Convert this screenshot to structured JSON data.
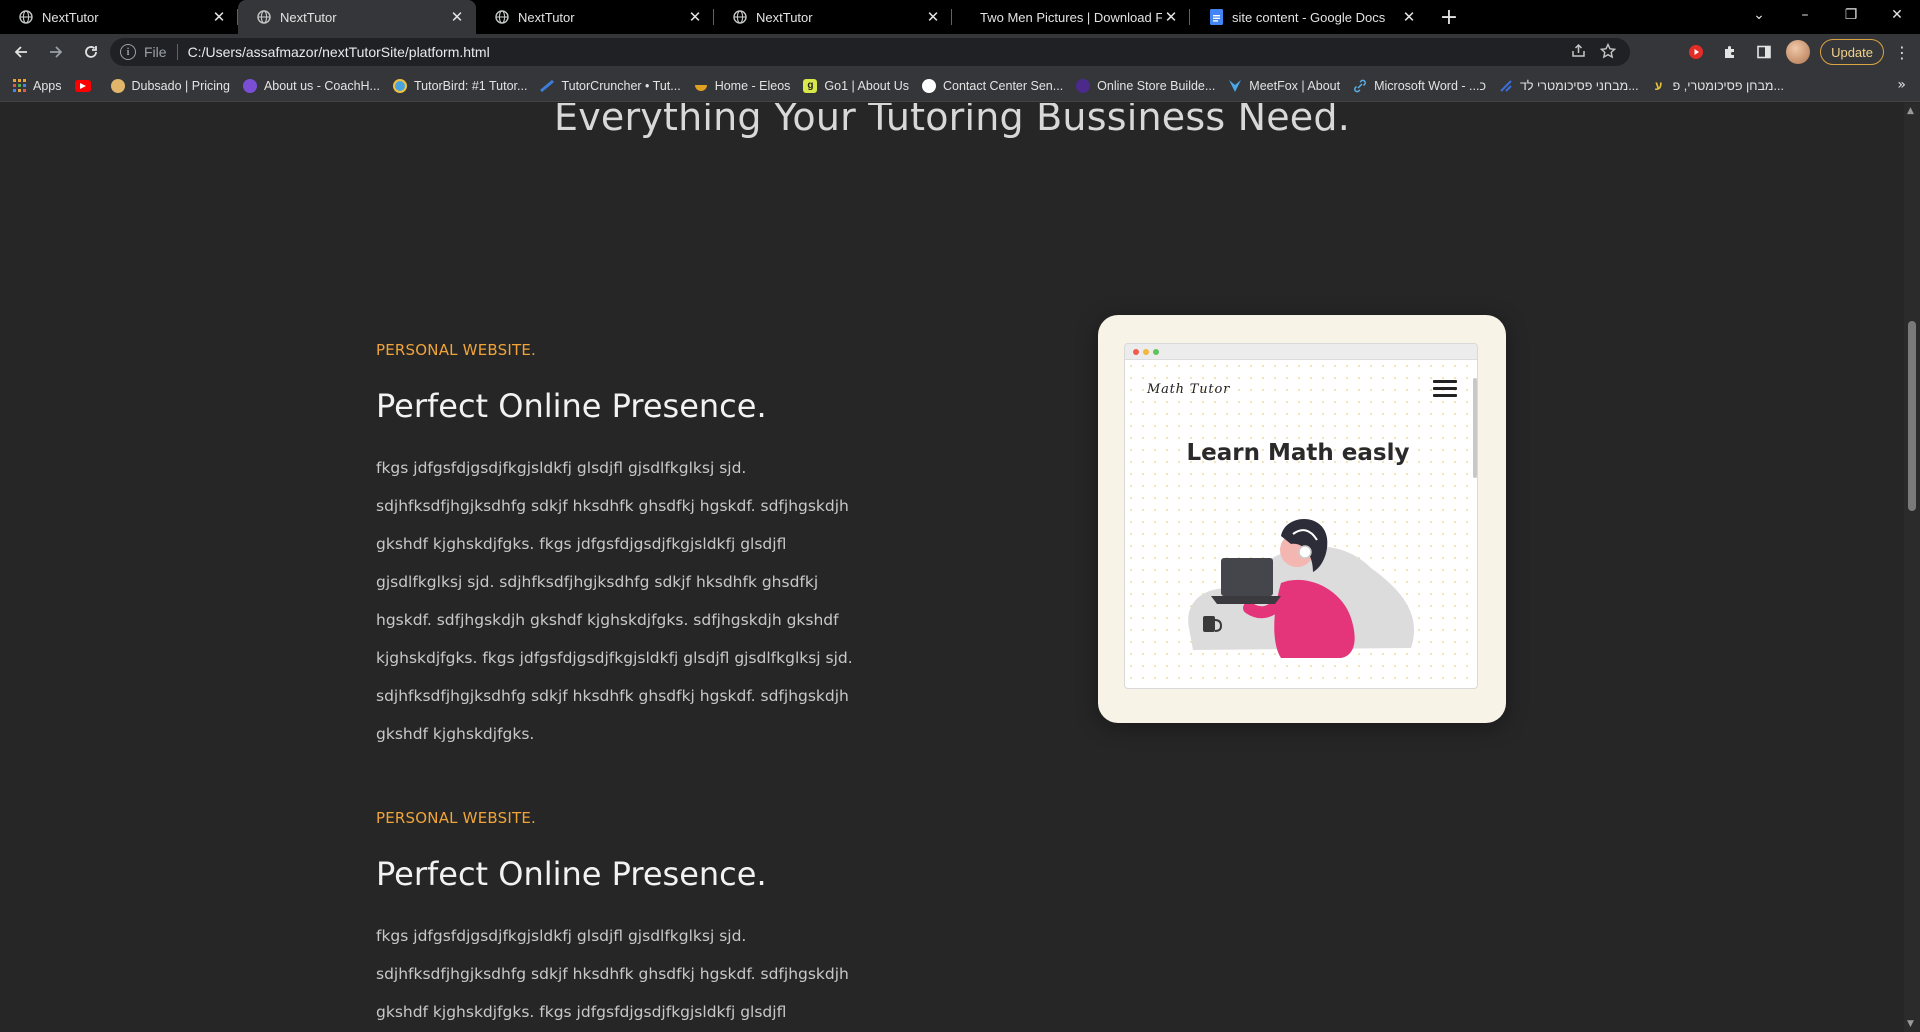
{
  "browser": {
    "tabs": [
      {
        "title": "NextTutor",
        "active": false,
        "icon": "globe-icon"
      },
      {
        "title": "NextTutor",
        "active": true,
        "icon": "globe-icon"
      },
      {
        "title": "NextTutor",
        "active": false,
        "icon": "globe-icon"
      },
      {
        "title": "NextTutor",
        "active": false,
        "icon": "globe-icon"
      },
      {
        "title": "Two Men Pictures | Download Fre",
        "active": false,
        "icon": "none"
      },
      {
        "title": "site content - Google Docs",
        "active": false,
        "icon": "google-docs-icon"
      }
    ],
    "new_tab": "+",
    "window_controls": {
      "minimize": "–",
      "restore": "❐",
      "close": "✕",
      "tab_search": "⌄"
    },
    "toolbar": {
      "scheme_label": "File",
      "url": "C:/Users/assafmazor/nextTutorSite/platform.html",
      "update_label": "Update"
    },
    "bookmarks": [
      {
        "label": "Apps",
        "icon": "apps-grid-icon",
        "color": "#e8a33b"
      },
      {
        "label": "",
        "icon": "youtube-icon",
        "color": "#ff0000"
      },
      {
        "label": "Dubsado | Pricing",
        "icon": "dubsado-icon",
        "color": "#e2b66a"
      },
      {
        "label": "About us - CoachH...",
        "icon": "coachhub-icon",
        "color": "#7a4fd6"
      },
      {
        "label": "TutorBird: #1 Tutor...",
        "icon": "tutorbird-icon",
        "color": "#4aa3df"
      },
      {
        "label": "TutorCruncher • Tut...",
        "icon": "tutorcruncher-icon",
        "color": "#3b7dd8"
      },
      {
        "label": "Home - Eleos",
        "icon": "eleos-icon",
        "color": "#e0a020"
      },
      {
        "label": "Go1 | About Us",
        "icon": "go1-icon",
        "color": "#d8e84a"
      },
      {
        "label": "Contact Center Sen...",
        "icon": "contact-center-icon",
        "color": "#cccccc"
      },
      {
        "label": "Online Store Builde...",
        "icon": "store-icon",
        "color": "#4b2a8c"
      },
      {
        "label": "MeetFox | About",
        "icon": "meetfox-icon",
        "color": "#4aa8e8"
      },
      {
        "label": "Microsoft Word - ...כ",
        "icon": "link-icon",
        "color": "#5ab0e8"
      },
      {
        "label": "מבחני פסיכומטרי לד...",
        "icon": "psychometric-icon",
        "color": "#3a6ed8"
      },
      {
        "label": "מבחן פסיכומטרי, פ...",
        "icon": "exam-icon",
        "color": "#e8c53b"
      }
    ],
    "bookmarks_more": "»"
  },
  "page": {
    "hero_title": "Everything Your Tutoring Bussiness Need.",
    "features": [
      {
        "eyebrow": "PERSONAL WEBSITE.",
        "heading": "Perfect Online Presence.",
        "body": "fkgs jdfgsfdjgsdjfkgjsldkfj glsdjfl gjsdlfkglksj sjd. sdjhfksdfjhgjksdhfg sdkjf hksdhfk ghsdfkj hgskdf. sdfjhgskdjh gkshdf kjghskdjfgks. fkgs jdfgsfdjgsdjfkgjsldkfj glsdjfl gjsdlfkglksj sjd. sdjhfksdfjhgjksdhfg sdkjf hksdhfk ghsdfkj hgskdf. sdfjhgskdjh gkshdf kjghskdjfgks. sdfjhgskdjh gkshdf kjghskdjfgks. fkgs jdfgsfdjgsdjfkgjsldkfj glsdjfl gjsdlfkglksj sjd. sdjhfksdfjhgjksdhfg sdkjf hksdhfk ghsdfkj hgskdf. sdfjhgskdjh gkshdf kjghskdjfgks."
      },
      {
        "eyebrow": "PERSONAL WEBSITE.",
        "heading": "Perfect Online Presence.",
        "body": "fkgs jdfgsfdjgsdjfkgjsldkfj glsdjfl gjsdlfkglksj sjd. sdjhfksdfjhgjksdhfg sdkjf hksdhfk ghsdfkj hgskdf. sdfjhgskdjh gkshdf kjghskdjfgks. fkgs jdfgsfdjgsdjfkgjsldkfj glsdjfl gjsdlfkglksj"
      }
    ],
    "mockup": {
      "brand": "Math Tutor",
      "headline": "Learn Math easly"
    }
  },
  "colors": {
    "page_bg": "#262626",
    "accent": "#f0a43a",
    "mock_frame": "#f8f3e7",
    "illustration_pink": "#e5357a"
  }
}
